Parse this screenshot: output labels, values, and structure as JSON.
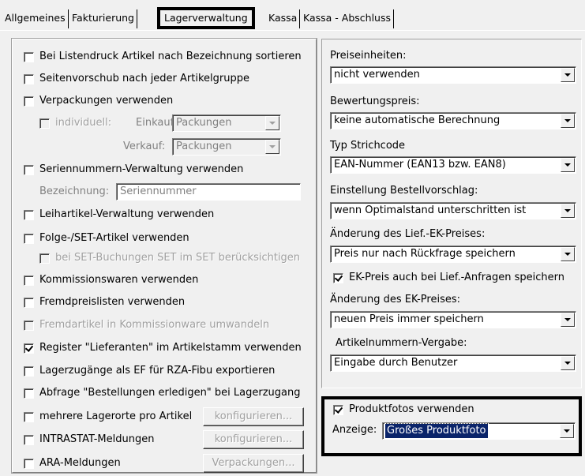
{
  "tabs": [
    {
      "label": "Allgemeines"
    },
    {
      "label": "Fakturierung"
    },
    {
      "label": "Lagerverwaltung"
    },
    {
      "label": "Kassa"
    },
    {
      "label": "Kassa - Abschluss"
    }
  ],
  "left": {
    "sort_by_name": {
      "label": "Bei Listendruck Artikel nach Bezeichnung sortieren",
      "checked": false
    },
    "page_break": {
      "label": "Seitenvorschub nach jeder Artikelgruppe",
      "checked": false
    },
    "packaging": {
      "label": "Verpackungen verwenden",
      "checked": false
    },
    "individual": {
      "label": "individuell:",
      "checked": false
    },
    "purchase_label": "Einkauf:",
    "purchase_value": "Packungen",
    "sale_label": "Verkauf:",
    "sale_value": "Packungen",
    "serial": {
      "label": "Seriennummern-Verwaltung verwenden",
      "checked": false
    },
    "designation_label": "Bezeichnung:",
    "designation_value": "Seriennummer",
    "rental": {
      "label": "Leihartikel-Verwaltung verwenden",
      "checked": false
    },
    "followup": {
      "label": "Folge-/SET-Artikel verwenden",
      "checked": false
    },
    "set_in_set": {
      "label": "bei SET-Buchungen SET im SET berücksichtigen",
      "checked": false
    },
    "commission": {
      "label": "Kommissionswaren verwenden",
      "checked": false
    },
    "foreign_price": {
      "label": "Fremdpreislisten verwenden",
      "checked": false
    },
    "foreign_article": {
      "label": "Fremdartikel in Kommissionware umwandeln",
      "checked": false
    },
    "suppliers_tab": {
      "label": "Register \"Lieferanten\" im Artikelstamm verwenden",
      "checked": true
    },
    "export_ef": {
      "label": "Lagerzugänge als EF für RZA-Fibu exportieren",
      "checked": false
    },
    "orders_query": {
      "label": "Abfrage \"Bestellungen erledigen\" bei Lagerzugang",
      "checked": false
    },
    "multi_location": {
      "label": "mehrere Lagerorte pro Artikel",
      "checked": false
    },
    "multi_location_btn": "konfigurieren...",
    "intrastat": {
      "label": "INTRASTAT-Meldungen",
      "checked": false
    },
    "intrastat_btn": "konfigurieren...",
    "ara": {
      "label": "ARA-Meldungen",
      "checked": false
    },
    "ara_btn": "Verpackungen..."
  },
  "right": {
    "price_units_label": "Preiseinheiten:",
    "price_units_value": "nicht verwenden",
    "valuation_label": "Bewertungspreis:",
    "valuation_value": "keine automatische Berechnung",
    "barcode_label": "Typ Strichcode",
    "barcode_value": "EAN-Nummer (EAN13 bzw. EAN8)",
    "order_suggest_label": "Einstellung Bestellvorschlag:",
    "order_suggest_value": "wenn Optimalstand unterschritten ist",
    "supplier_price_label": "Änderung des Lief.-EK-Preises:",
    "supplier_price_value": "Preis nur nach Rückfrage speichern",
    "ek_on_inquiry": {
      "label": "EK-Preis auch bei Lief.-Anfragen speichern",
      "checked": true
    },
    "ek_change_label": "Änderung des EK-Preises:",
    "ek_change_value": "neuen Preis immer speichern",
    "article_numbers_label": "Artikelnummern-Vergabe:",
    "article_numbers_value": "Eingabe durch Benutzer",
    "product_photos": {
      "label": "Produktfotos verwenden",
      "checked": true
    },
    "display_label": "Anzeige:",
    "display_value": "Großes Produktfoto"
  }
}
